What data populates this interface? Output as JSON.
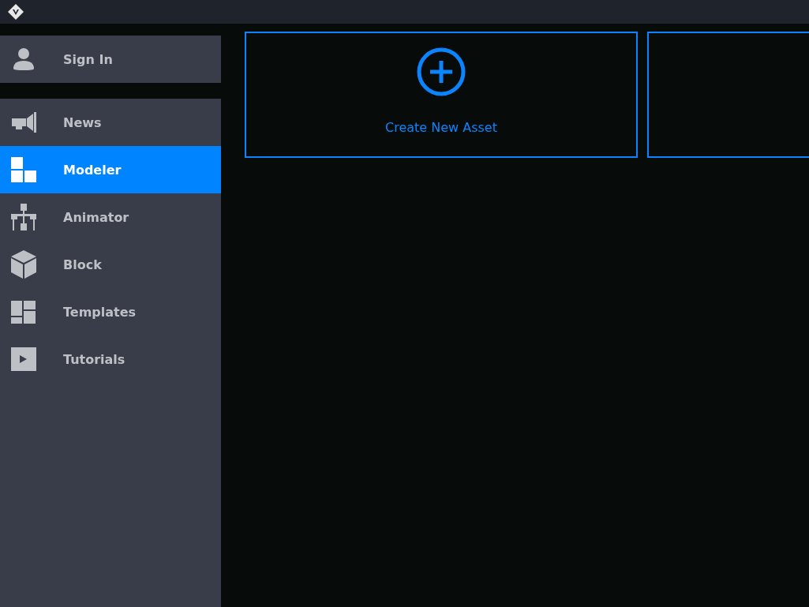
{
  "account": {
    "label": "Sign In"
  },
  "nav": [
    {
      "kind": "news",
      "label": "News",
      "selected": false
    },
    {
      "kind": "modeler",
      "label": "Modeler",
      "selected": true
    },
    {
      "kind": "animator",
      "label": "Animator",
      "selected": false
    },
    {
      "kind": "block",
      "label": "Block",
      "selected": false
    },
    {
      "kind": "templates",
      "label": "Templates",
      "selected": false
    },
    {
      "kind": "tutorials",
      "label": "Tutorials",
      "selected": false
    }
  ],
  "cards": [
    {
      "kind": "create",
      "label": "Create New Asset"
    },
    {
      "kind": "empty"
    }
  ]
}
